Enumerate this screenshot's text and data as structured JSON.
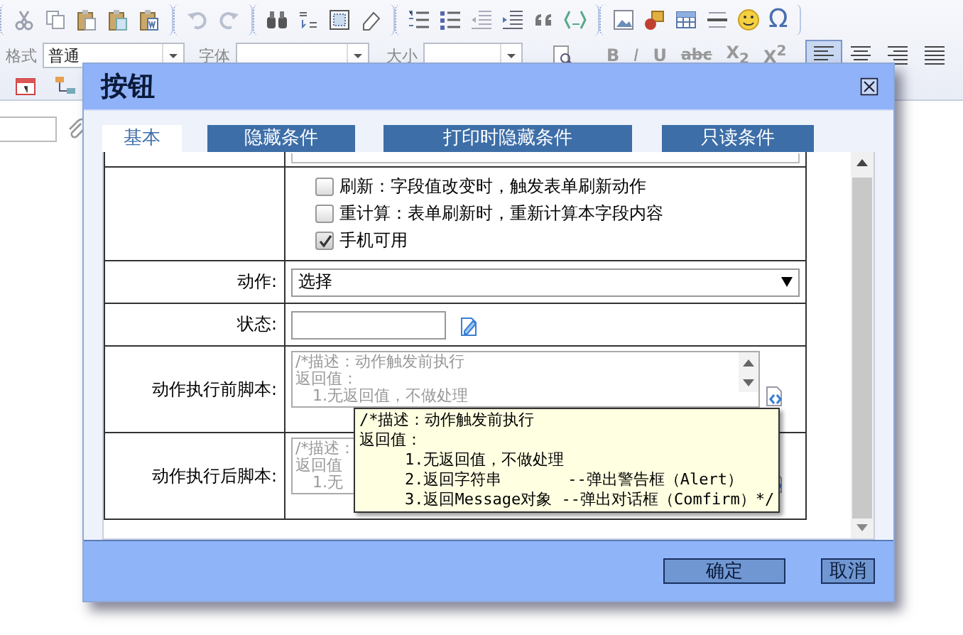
{
  "toolbar": {
    "special_char": "Ω",
    "format_label": "格式",
    "format_value": "普通",
    "font_label": "字体",
    "size_label": "大小",
    "style_buttons": [
      "B",
      "I",
      "U",
      "abc",
      "X$_{2}$",
      "X$^{2}$"
    ],
    "align_buttons": [
      {
        "selected": true
      },
      {
        "selected": false
      },
      {
        "selected": false
      },
      {
        "selected": false
      }
    ]
  },
  "dialog": {
    "title": "按钮",
    "tabs": [
      {
        "label": "基本",
        "selected": true
      },
      {
        "label": "隐藏条件",
        "selected": false
      },
      {
        "label": "打印时隐藏条件",
        "selected": false
      },
      {
        "label": "只读条件",
        "selected": false
      }
    ],
    "rows": [
      {
        "kind": "cut_field"
      },
      {
        "kind": "checkboxes",
        "options": [
          {
            "label": "刷新：字段值改变时，触发表单刷新动作",
            "checked": false
          },
          {
            "label": "重计算：表单刷新时，重新计算本字段内容",
            "checked": false
          },
          {
            "label": "手机可用",
            "checked": true
          }
        ]
      },
      {
        "kind": "select",
        "label": "动作:",
        "value": "选择"
      },
      {
        "kind": "text",
        "label": "状态:"
      },
      {
        "kind": "script",
        "label": "动作执行前脚本:",
        "lines": [
          "/*描述：动作触发前执行",
          "返回值：",
          "1.无返回值，不做处理"
        ]
      },
      {
        "kind": "script",
        "label": "动作执行后脚本:",
        "lines": [
          "/*描述：",
          "返回值",
          "1.无"
        ]
      }
    ],
    "buttons": [
      "确定",
      "取消"
    ]
  },
  "tooltip": {
    "lines": [
      {
        "text": "/*描述：动作触发前执行",
        "indent": false
      },
      {
        "text": "返回值：",
        "indent": false
      },
      {
        "text": "1.无返回值，不做处理",
        "indent": true
      },
      {
        "text": "2.返回字符串       --弹出警告框（Alert）",
        "indent": true
      },
      {
        "text": "3.返回Message对象 --弹出对话框（Comfirm）*/",
        "indent": true
      }
    ]
  }
}
